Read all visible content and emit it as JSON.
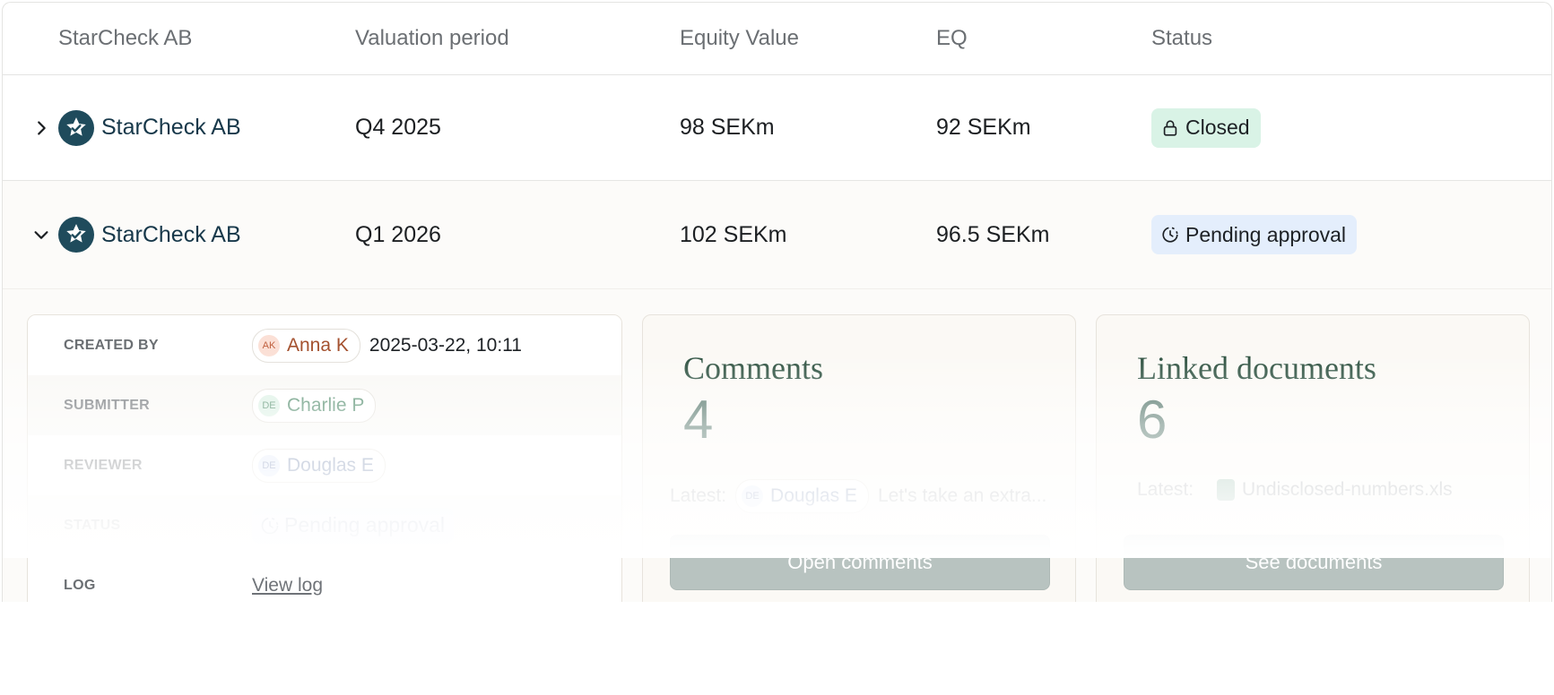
{
  "header": {
    "company": "StarCheck AB",
    "period": "Valuation period",
    "equity": "Equity Value",
    "eq": "EQ",
    "status": "Status"
  },
  "rows": [
    {
      "company": "StarCheck AB",
      "period": "Q4 2025",
      "equity": "98 SEKm",
      "eq": "92 SEKm",
      "status": "Closed",
      "status_icon": "lock-icon",
      "expanded": false
    },
    {
      "company": "StarCheck AB",
      "period": "Q1 2026",
      "equity": "102 SEKm",
      "eq": "96.5 SEKm",
      "status": "Pending approval",
      "status_icon": "clock-icon",
      "expanded": true
    }
  ],
  "details": {
    "created_by": {
      "label": "CREATED BY",
      "initials": "AK",
      "name": "Anna K",
      "date": "2025-03-22, 10:11"
    },
    "submitter": {
      "label": "SUBMITTER",
      "initials": "DE",
      "name": "Charlie P"
    },
    "reviewer": {
      "label": "REVIEWER",
      "initials": "DE",
      "name": "Douglas E"
    },
    "status": {
      "label": "STATUS",
      "value": "Pending approval"
    },
    "log": {
      "label": "LOG",
      "link": "View log"
    }
  },
  "comments": {
    "title": "Comments",
    "count": "4",
    "latest_label": "Latest:",
    "latest_initials": "DE",
    "latest_author": "Douglas E",
    "latest_text": "Let's take an extra...",
    "button": "Open comments"
  },
  "documents": {
    "title": "Linked documents",
    "count": "6",
    "latest_label": "Latest:",
    "latest_file": "Undisclosed-numbers.xls",
    "button": "See documents"
  },
  "colors": {
    "closed_badge": "#d9f3e6",
    "pending_badge": "#e4eefc",
    "logo": "#1f4b5c",
    "stat_title": "#2b4f3e",
    "button": "#b8c3c0"
  }
}
